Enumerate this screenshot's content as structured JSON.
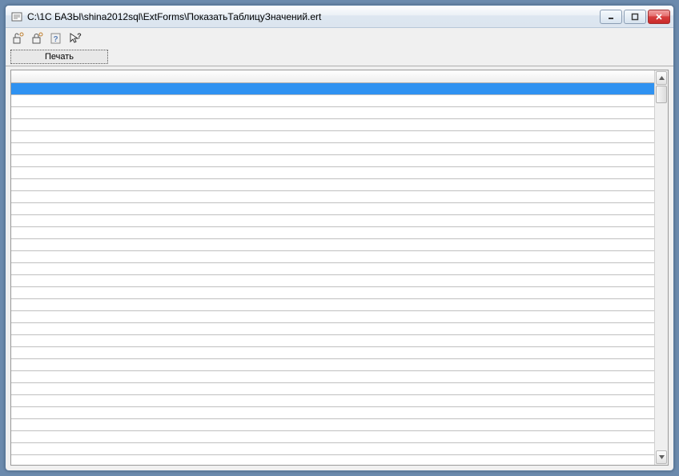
{
  "window": {
    "title": "C:\\1С БАЗЫ\\shina2012sql\\ExtForms\\ПоказатьТаблицуЗначений.ert"
  },
  "toolbar": {
    "print_label": "Печать"
  },
  "grid": {
    "row_count": 31,
    "selected_index": 0
  }
}
